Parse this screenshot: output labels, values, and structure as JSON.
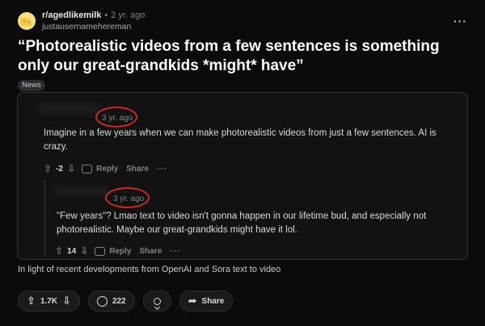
{
  "post": {
    "subreddit": "r/agedlikemilk",
    "age": "2 yr. ago",
    "username": "justausernamehereman",
    "title": "“Photorealistic videos from a few sentences is something only our great-grandkids *might* have”",
    "flair": "News",
    "caption": "In light of recent developments from OpenAI and Sora text to video"
  },
  "embed": {
    "comments": [
      {
        "age": "3 yr. ago",
        "text": "Imagine in a few years when we can make photorealistic videos from just a few sentences. AI is crazy.",
        "score": "-2",
        "reply_label": "Reply",
        "share_label": "Share"
      },
      {
        "age": "3 yr. ago",
        "text": "\"Few years\"? Lmao text to video isn't gonna happen in our lifetime bud, and especially not photorealistic. Maybe our great-grandkids might have it lol.",
        "score": "14",
        "reply_label": "Reply",
        "share_label": "Share"
      }
    ],
    "highlight_color": "#c92a1b"
  },
  "actions": {
    "upvotes": "1.7K",
    "comments": "222",
    "share_label": "Share"
  },
  "icons": [
    "avatar-cheese",
    "more-icon",
    "upvote-icon",
    "downvote-icon",
    "comment-icon",
    "award-icon",
    "share-icon"
  ]
}
